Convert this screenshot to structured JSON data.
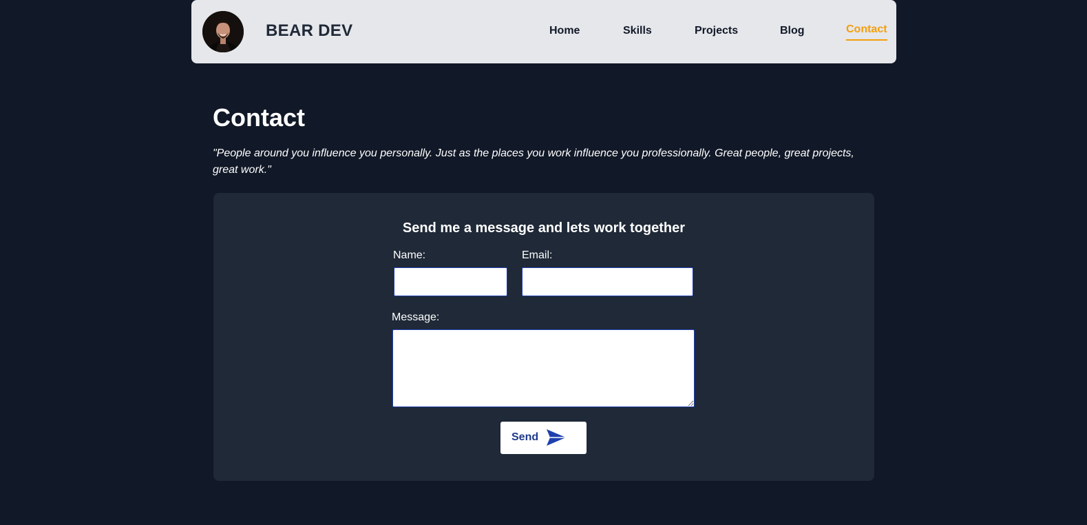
{
  "header": {
    "brand": "BEAR DEV",
    "avatar_icon": "profile-photo",
    "nav": {
      "home": "Home",
      "skills": "Skills",
      "projects": "Projects",
      "blog": "Blog",
      "contact": "Contact"
    },
    "active_nav": "contact"
  },
  "main": {
    "title": "Contact",
    "quote": "\"People around you influence you personally. Just as the places you work influence you professionally. Great people, great projects, great work.\""
  },
  "form": {
    "heading": "Send me a message and lets work together",
    "name_label": "Name:",
    "name_value": "",
    "email_label": "Email:",
    "email_value": "",
    "message_label": "Message:",
    "message_value": "",
    "send_label": "Send",
    "send_icon": "paper-plane-icon"
  },
  "colors": {
    "background": "#111827",
    "navbar": "#e5e7eb",
    "card": "#1f2937",
    "accent": "#f59e0b",
    "button_text": "#1e3a8a"
  }
}
